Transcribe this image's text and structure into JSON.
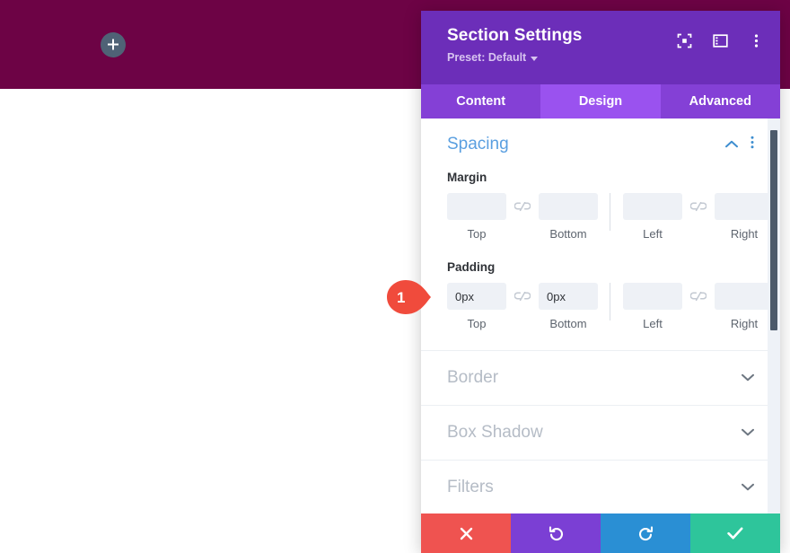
{
  "page": {
    "hero": {
      "background_color": "#6d0345",
      "add_button": {
        "icon": "plus-icon",
        "label": "+",
        "color": "#4f6276"
      }
    },
    "body_background": "#ffffff"
  },
  "modal": {
    "title": "Section Settings",
    "preset_label": "Preset: Default",
    "preset_caret_icon": "caret-down-icon",
    "header_color": "#6c2eb9",
    "header_icons": [
      {
        "name": "expand-focus-icon",
        "title": "Expand"
      },
      {
        "name": "panel-layout-icon",
        "title": "Layout"
      },
      {
        "name": "more-options-icon",
        "title": "More"
      }
    ],
    "tabs": [
      {
        "label": "Content",
        "active": false
      },
      {
        "label": "Design",
        "active": true
      },
      {
        "label": "Advanced",
        "active": false
      }
    ],
    "sections": [
      {
        "title": "Spacing",
        "open": true,
        "chevron_icon": "chevron-up-icon",
        "more_icon": "more-options-icon",
        "fields": [
          {
            "label": "Margin",
            "link_icon": "broken-link-icon",
            "inputs": [
              {
                "caption": "Top",
                "value": "",
                "placeholder": ""
              },
              {
                "caption": "Bottom",
                "value": "",
                "placeholder": ""
              },
              {
                "caption": "Left",
                "value": "",
                "placeholder": ""
              },
              {
                "caption": "Right",
                "value": "",
                "placeholder": ""
              }
            ]
          },
          {
            "label": "Padding",
            "link_icon": "broken-link-icon",
            "inputs": [
              {
                "caption": "Top",
                "value": "0px",
                "placeholder": ""
              },
              {
                "caption": "Bottom",
                "value": "0px",
                "placeholder": ""
              },
              {
                "caption": "Left",
                "value": "",
                "placeholder": ""
              },
              {
                "caption": "Right",
                "value": "",
                "placeholder": ""
              }
            ]
          }
        ]
      },
      {
        "title": "Border",
        "open": false,
        "chevron_icon": "chevron-down-icon"
      },
      {
        "title": "Box Shadow",
        "open": false,
        "chevron_icon": "chevron-down-icon"
      },
      {
        "title": "Filters",
        "open": false,
        "chevron_icon": "chevron-down-icon"
      }
    ],
    "scrollbar": {
      "thumb_color": "#4c5a6b",
      "track_color": "#eef2f7"
    },
    "footer_buttons": [
      {
        "name": "cancel-button",
        "icon": "close-x-icon",
        "color": "#ef5350"
      },
      {
        "name": "undo-button",
        "icon": "undo-icon",
        "color": "#7b3fd4"
      },
      {
        "name": "redo-button",
        "icon": "redo-icon",
        "color": "#2a8fd4"
      },
      {
        "name": "save-button",
        "icon": "checkmark-icon",
        "color": "#2ec59b"
      }
    ]
  },
  "annotation": {
    "callout_number": "1",
    "color": "#f04b3c"
  }
}
